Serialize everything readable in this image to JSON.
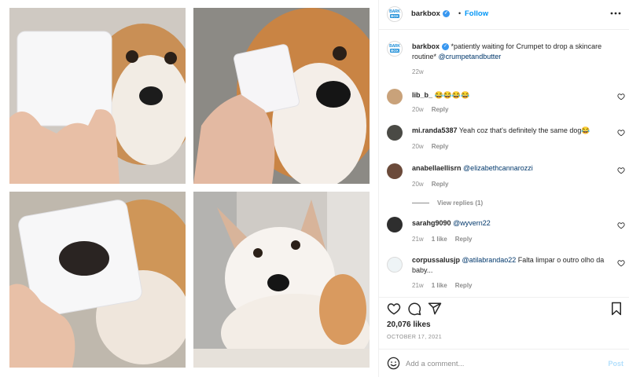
{
  "header": {
    "logo_line1": "BARK",
    "logo_line2": "BOX",
    "username": "barkbox",
    "separator": "•",
    "follow_label": "Follow"
  },
  "caption": {
    "username": "barkbox",
    "text": " *patiently waiting for Crumpet to drop a skincare routine* ",
    "mention": "@crumpetandbutter",
    "time": "22w"
  },
  "comments": [
    {
      "username": "lib_b_",
      "text": " 😂😂😂😂",
      "time": "20w",
      "likes": "",
      "reply": "Reply"
    },
    {
      "username": "mi.randa5387",
      "text": " Yeah coz that's definitely the same dog😂",
      "time": "20w",
      "likes": "",
      "reply": "Reply"
    },
    {
      "username": "anabellaellisrn",
      "mention": "@elizabethcannarozzi",
      "time": "20w",
      "likes": "",
      "reply": "Reply",
      "view_replies": "View replies (1)"
    },
    {
      "username": "sarahg9090",
      "mention": "@wyvern22",
      "time": "21w",
      "likes": "1 like",
      "reply": "Reply"
    },
    {
      "username": "corpussalusjp",
      "mention": "@atilabrandao22",
      "text": " Falta limpar o outro olho da baby...",
      "time": "21w",
      "likes": "1 like",
      "reply": "Reply"
    }
  ],
  "actions": {
    "likes": "20,076 likes",
    "date": "OCTOBER 17, 2021"
  },
  "add_comment": {
    "placeholder": "Add a comment...",
    "post_label": "Post"
  },
  "colors": {
    "accent": "#0095f6",
    "verified": "#3897f0",
    "muted": "#8e8e8e",
    "post_disabled": "#b2dffc"
  },
  "icons": [
    "verified-badge-icon",
    "more-options-icon",
    "heart-icon",
    "comment-icon",
    "share-icon",
    "bookmark-icon",
    "emoji-icon"
  ]
}
